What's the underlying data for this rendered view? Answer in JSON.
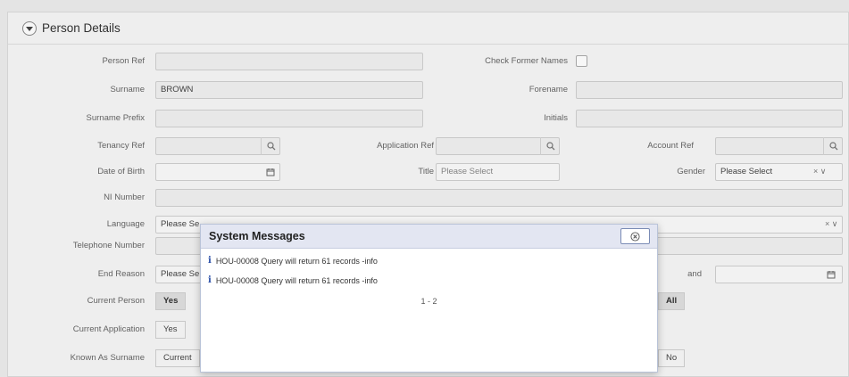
{
  "panel": {
    "title": "Person Details"
  },
  "fields": {
    "person_ref": {
      "label": "Person Ref",
      "value": ""
    },
    "check_former_names": {
      "label": "Check Former Names"
    },
    "surname": {
      "label": "Surname",
      "value": "BROWN"
    },
    "forename": {
      "label": "Forename",
      "value": ""
    },
    "surname_prefix": {
      "label": "Surname Prefix",
      "value": ""
    },
    "initials": {
      "label": "Initials",
      "value": ""
    },
    "tenancy_ref": {
      "label": "Tenancy Ref",
      "value": ""
    },
    "application_ref": {
      "label": "Application Ref",
      "value": ""
    },
    "account_ref": {
      "label": "Account Ref",
      "value": ""
    },
    "date_of_birth": {
      "label": "Date of Birth",
      "value": ""
    },
    "title": {
      "label": "Title",
      "value": "Please Select"
    },
    "gender": {
      "label": "Gender",
      "value": "Please Select"
    },
    "ni_number": {
      "label": "NI Number",
      "value": ""
    },
    "language": {
      "label": "Language",
      "value": "Please Se"
    },
    "telephone_number": {
      "label": "Telephone Number",
      "value": ""
    },
    "end_reason": {
      "label": "End Reason",
      "value": "Please Se"
    },
    "and": {
      "label": "and",
      "value": ""
    },
    "current_person": {
      "label": "Current Person",
      "options": [
        "Yes"
      ],
      "right_option": "All"
    },
    "current_application": {
      "label": "Current Application",
      "options": [
        "Yes"
      ]
    },
    "known_as_surname": {
      "label": "Known As Surname",
      "options": [
        "Current"
      ],
      "right_option": "No"
    }
  },
  "dialog": {
    "title": "System Messages",
    "messages": [
      "HOU-00008 Query will return 61 records -info",
      "HOU-00008 Query will return 61 records -info"
    ],
    "pager": "1 - 2"
  },
  "colors": {
    "dialog_header": "#e3e6f2",
    "info_icon": "#2b4fa8"
  }
}
